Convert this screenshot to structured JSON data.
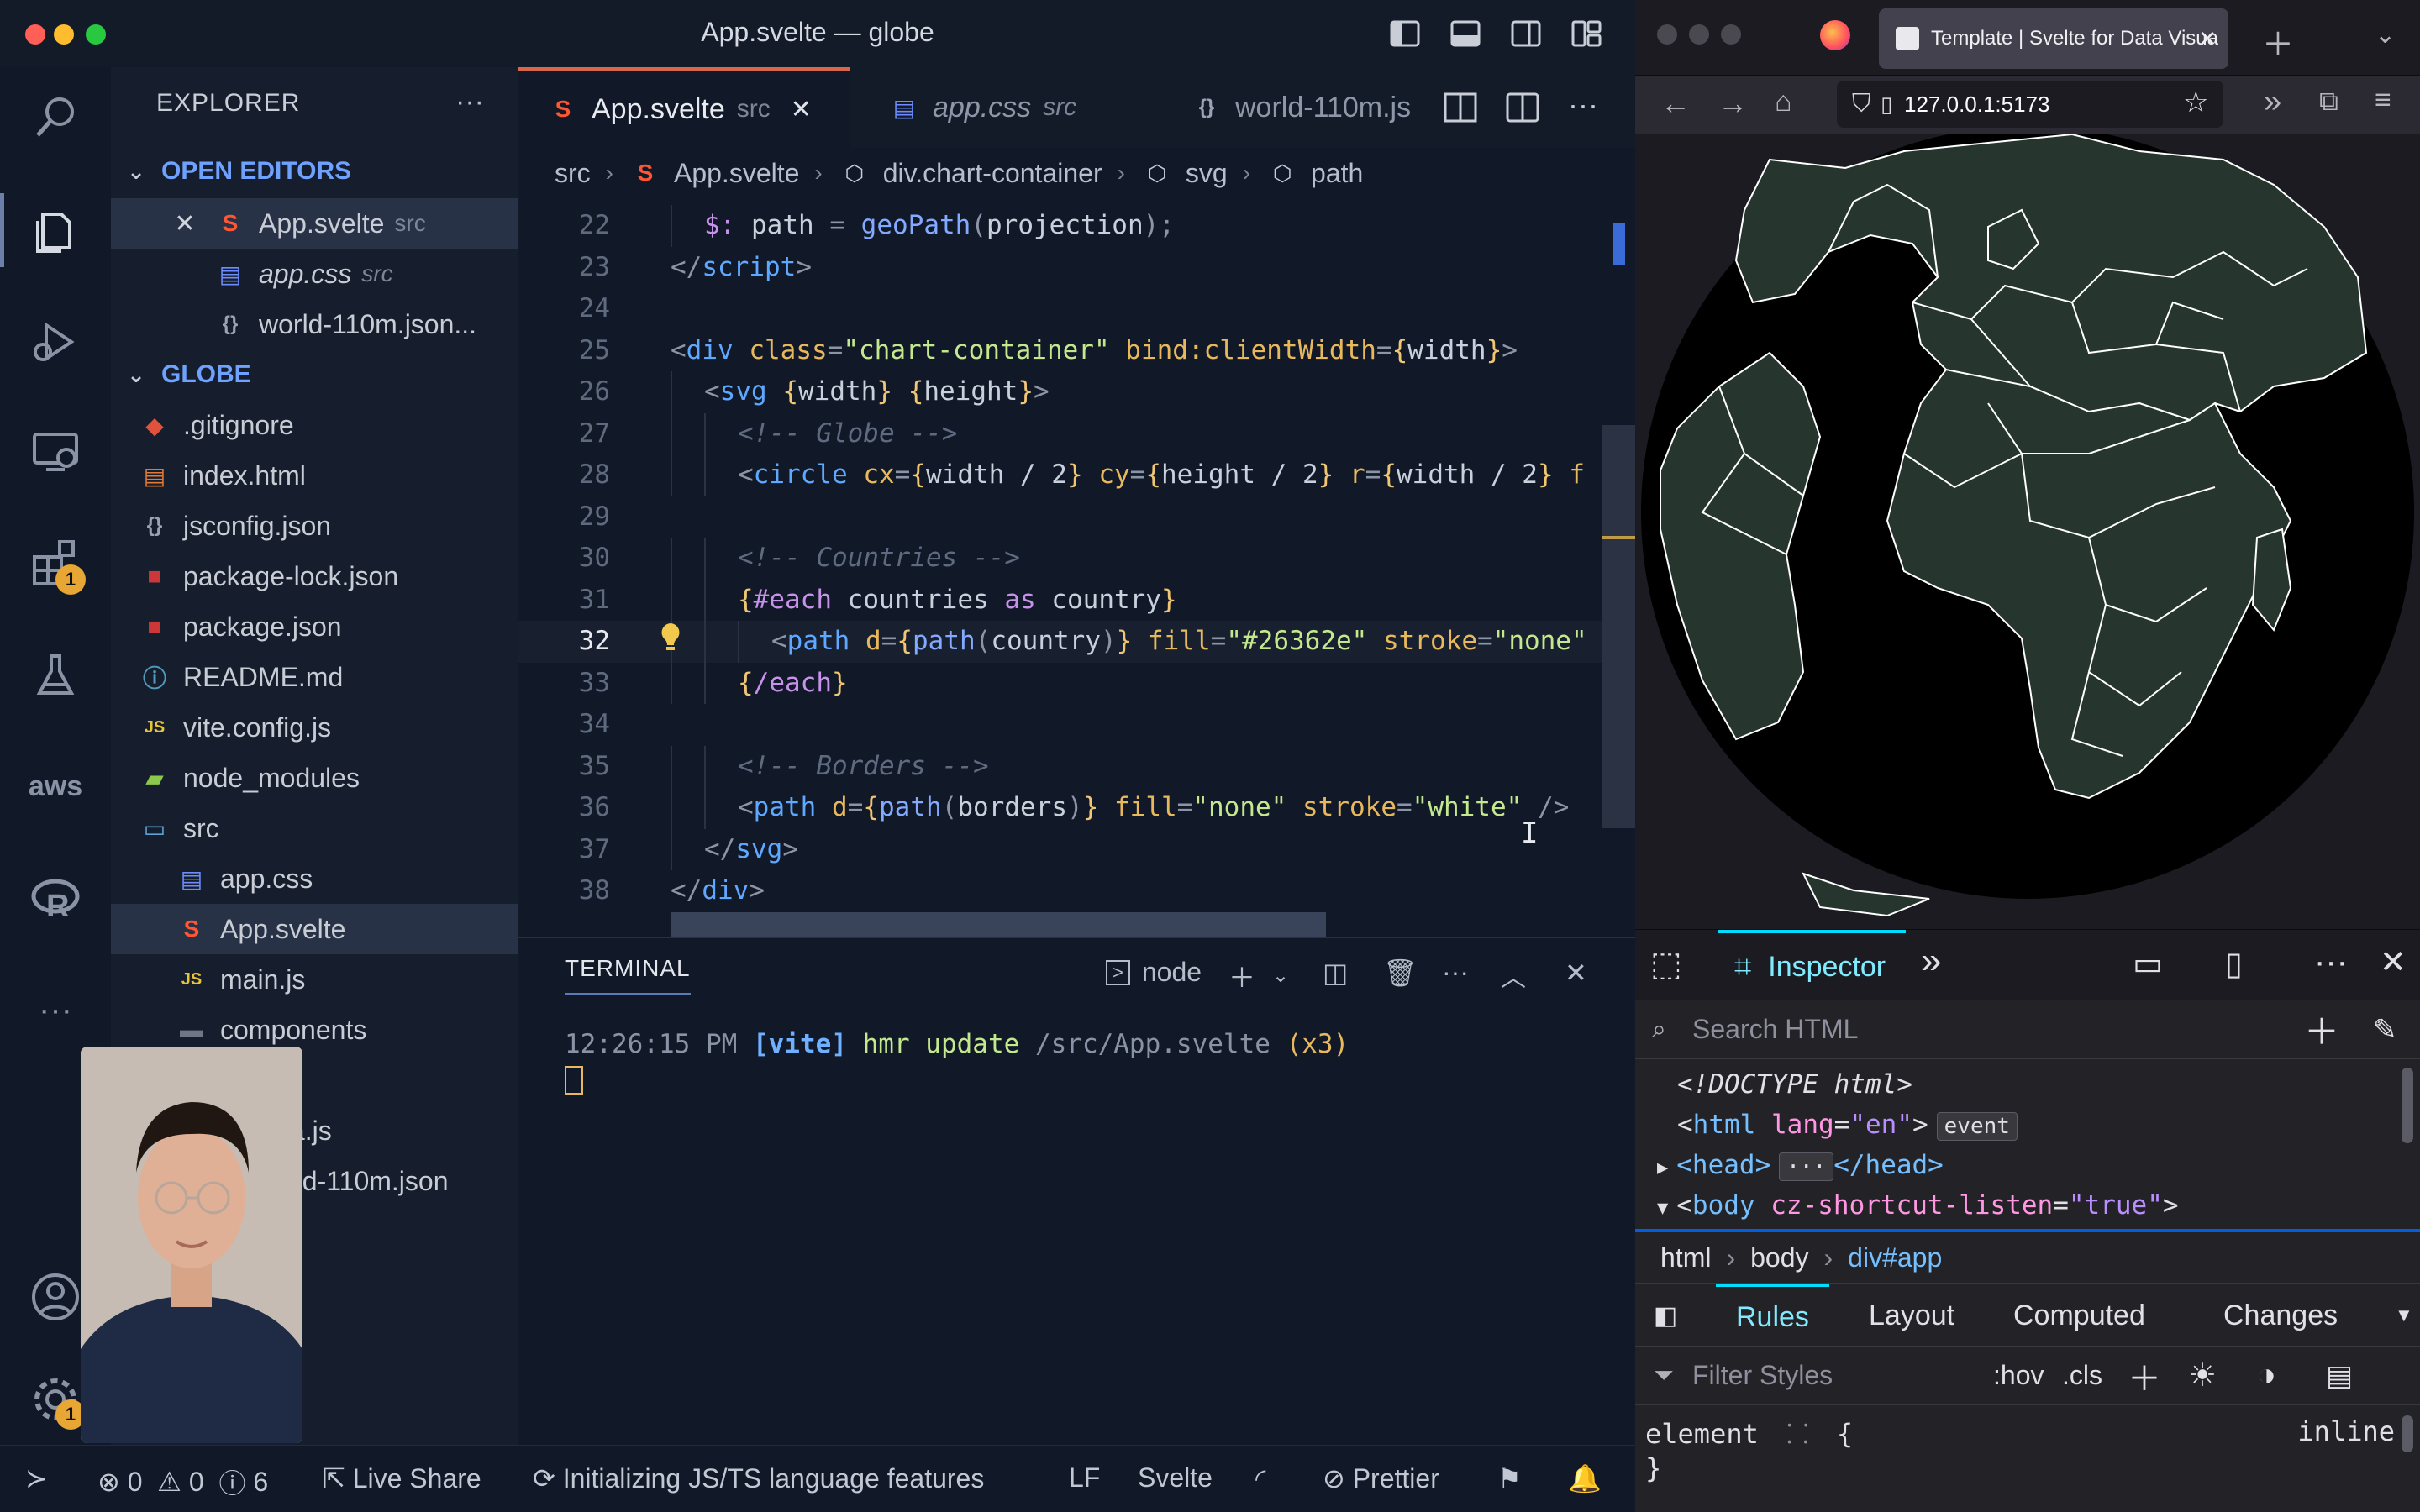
{
  "vscode": {
    "title": "App.svelte — globe",
    "explorer_label": "EXPLORER",
    "sidebar_more": "···",
    "open_editors": {
      "label": "OPEN EDITORS",
      "items": [
        {
          "name": "App.svelte",
          "desc": "src"
        },
        {
          "name": "app.css",
          "desc": "src"
        },
        {
          "name": "world-110m.json...",
          "desc": ""
        }
      ]
    },
    "project": {
      "label": "GLOBE",
      "items": [
        {
          "name": ".gitignore"
        },
        {
          "name": "index.html"
        },
        {
          "name": "jsconfig.json"
        },
        {
          "name": "package-lock.json"
        },
        {
          "name": "package.json"
        },
        {
          "name": "README.md"
        },
        {
          "name": "vite.config.js"
        },
        {
          "name": "node_modules"
        },
        {
          "name": "src"
        },
        {
          "name": "app.css"
        },
        {
          "name": "App.svelte"
        },
        {
          "name": "main.js"
        },
        {
          "name": "components"
        },
        {
          "name": "ta.js"
        },
        {
          "name": "rld-110m.json"
        }
      ]
    },
    "activity_badges": {
      "extensions": "1",
      "accounts": "1"
    },
    "activity_labels": {
      "aws": "aws"
    },
    "tabs": [
      {
        "name": "App.svelte",
        "desc": "src"
      },
      {
        "name": "app.css",
        "desc": "src"
      },
      {
        "name": "world-110m.js",
        "desc": ""
      }
    ],
    "breadcrumb": [
      "src",
      "App.svelte",
      "div.chart-container",
      "svg",
      "path"
    ],
    "code_lines": [
      {
        "n": "22",
        "indent": 1,
        "html": "<span class='t-kw'>$:</span> <span class='t-var'>path</span> <span class='t-pl'>=</span> <span class='t-fn'>geoPath</span><span class='t-pl'>(</span><span class='t-var'>projection</span><span class='t-pl'>);</span>"
      },
      {
        "n": "23",
        "indent": 0,
        "html": "<span class='t-pl'>&lt;/</span><span class='t-tag'>script</span><span class='t-pl'>&gt;</span>"
      },
      {
        "n": "24",
        "indent": 0,
        "html": ""
      },
      {
        "n": "25",
        "indent": 0,
        "html": "<span class='t-pl'>&lt;</span><span class='t-tag'>div</span> <span class='t-attr'>class</span><span class='t-pl'>=</span><span class='t-str'>\"chart-container\"</span> <span class='t-attr'>bind:clientWidth</span><span class='t-pl'>=</span><span class='t-brace'>{</span><span class='t-var'>width</span><span class='t-brace'>}</span><span class='t-pl'>&gt;</span>"
      },
      {
        "n": "26",
        "indent": 1,
        "html": "<span class='t-pl'>&lt;</span><span class='t-tag'>svg</span> <span class='t-brace'>{</span><span class='t-var'>width</span><span class='t-brace'>}</span> <span class='t-brace'>{</span><span class='t-var'>height</span><span class='t-brace'>}</span><span class='t-pl'>&gt;</span>"
      },
      {
        "n": "27",
        "indent": 2,
        "html": "<span class='t-com'>&lt;!-- Globe --&gt;</span>"
      },
      {
        "n": "28",
        "indent": 2,
        "html": "<span class='t-pl'>&lt;</span><span class='t-tag'>circle</span> <span class='t-attr'>cx</span><span class='t-pl'>=</span><span class='t-brace'>{</span><span class='t-var'>width / 2</span><span class='t-brace'>}</span> <span class='t-attr'>cy</span><span class='t-pl'>=</span><span class='t-brace'>{</span><span class='t-var'>height / 2</span><span class='t-brace'>}</span> <span class='t-attr'>r</span><span class='t-pl'>=</span><span class='t-brace'>{</span><span class='t-var'>width / 2</span><span class='t-brace'>}</span> <span class='t-attr'>f</span>"
      },
      {
        "n": "29",
        "indent": 0,
        "html": ""
      },
      {
        "n": "30",
        "indent": 2,
        "html": "<span class='t-com'>&lt;!-- Countries --&gt;</span>"
      },
      {
        "n": "31",
        "indent": 2,
        "html": "<span class='t-brace'>{</span><span class='t-kw'>#each</span> <span class='t-var'>countries</span> <span class='t-kw'>as</span> <span class='t-var'>country</span><span class='t-brace'>}</span>"
      },
      {
        "n": "32",
        "indent": 3,
        "html": "<span class='t-pl'>&lt;</span><span class='t-tag'>path</span> <span class='t-attr'>d</span><span class='t-pl'>=</span><span class='t-brace'>{</span><span class='t-fn'>path</span><span class='t-pl'>(</span><span class='t-var'>country</span><span class='t-pl'>)</span><span class='t-brace'>}</span> <span class='t-attr'>fill</span><span class='t-pl'>=</span><span class='t-str'>\"#26362e\"</span> <span class='t-attr'>stroke</span><span class='t-pl'>=</span><span class='t-str'>\"none\"</span>",
        "current": true
      },
      {
        "n": "33",
        "indent": 2,
        "html": "<span class='t-brace'>{</span><span class='t-kw'>/each</span><span class='t-brace'>}</span>"
      },
      {
        "n": "34",
        "indent": 0,
        "html": ""
      },
      {
        "n": "35",
        "indent": 2,
        "html": "<span class='t-com'>&lt;!-- Borders --&gt;</span>"
      },
      {
        "n": "36",
        "indent": 2,
        "html": "<span class='t-pl'>&lt;</span><span class='t-tag'>path</span> <span class='t-attr'>d</span><span class='t-pl'>=</span><span class='t-brace'>{</span><span class='t-fn'>path</span><span class='t-pl'>(</span><span class='t-var'>borders</span><span class='t-pl'>)</span><span class='t-brace'>}</span> <span class='t-attr'>fill</span><span class='t-pl'>=</span><span class='t-str'>\"none\"</span> <span class='t-attr'>stroke</span><span class='t-pl'>=</span><span class='t-str'>\"white\"</span> <span class='t-pl'>/&gt;</span>"
      },
      {
        "n": "37",
        "indent": 1,
        "html": "<span class='t-pl'>&lt;/</span><span class='t-tag'>svg</span><span class='t-pl'>&gt;</span>"
      },
      {
        "n": "38",
        "indent": 0,
        "html": "<span class='t-pl'>&lt;/</span><span class='t-tag'>div</span><span class='t-pl'>&gt;</span>"
      }
    ],
    "terminal": {
      "label": "TERMINAL",
      "shell": "node",
      "line_time": "12:26:15 PM",
      "line_tag": "[vite]",
      "line_msg": "hmr update",
      "line_path": "/src/App.svelte",
      "line_count": "(x3)"
    },
    "status": {
      "errors": "0",
      "warnings": "0",
      "infos": "6",
      "live_share": "Live Share",
      "init": "Initializing JS/TS language features",
      "eol": "LF",
      "lang": "Svelte",
      "prettier": "Prettier"
    },
    "colors": {
      "accent": "#d8664e",
      "selection": "#283247",
      "folder_title": "#6fa2ff"
    }
  },
  "firefox": {
    "tab_title": "Template | Svelte for Data Visua",
    "url": "127.0.0.1:5173",
    "globe_fill": "#26362e",
    "devtools": {
      "inspector_label": "Inspector",
      "search_placeholder": "Search HTML",
      "markup": {
        "doctype": "<!DOCTYPE html>",
        "html_tag": "html",
        "html_attr": "lang",
        "html_val": "\"en\"",
        "event_pill": "event",
        "head_open": "<head>",
        "head_pill": "···",
        "head_close": "</head>",
        "body_tag": "body",
        "body_attr": "cz-shortcut-listen",
        "body_val": "\"true\""
      },
      "breadcrumbs": [
        "html",
        "body",
        "div#app"
      ],
      "rule_tabs": [
        "Rules",
        "Layout",
        "Computed",
        "Changes"
      ],
      "filter_placeholder": "Filter Styles",
      "hov": ":hov",
      "cls": ".cls",
      "rule_selector": "element",
      "rule_brace_open": "{",
      "rule_brace_close": "}",
      "rule_source": "inline"
    }
  }
}
